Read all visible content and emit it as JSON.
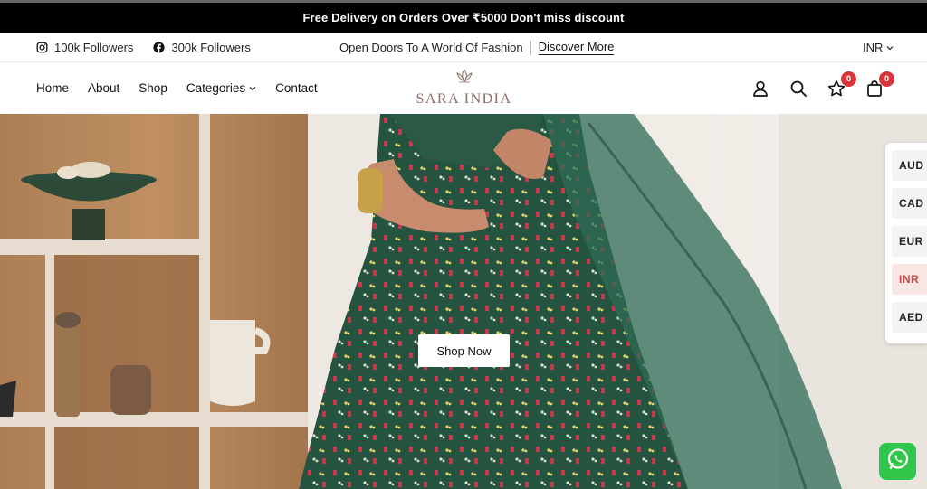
{
  "announcement": {
    "text": "Free Delivery on Orders Over ₹5000 Don't miss discount"
  },
  "utility": {
    "instagram_followers": "100k Followers",
    "facebook_followers": "300k Followers",
    "tagline": "Open Doors To A World Of Fashion",
    "discover_label": "Discover More",
    "currency_selected": "INR"
  },
  "nav": {
    "items": [
      {
        "label": "Home"
      },
      {
        "label": "About"
      },
      {
        "label": "Shop"
      },
      {
        "label": "Categories"
      },
      {
        "label": "Contact"
      }
    ]
  },
  "logo": {
    "text": "SARA INDIA"
  },
  "header_icons": {
    "wishlist_count": "0",
    "cart_count": "0",
    "icons": [
      "user-icon",
      "search-icon",
      "star-icon",
      "bag-icon"
    ]
  },
  "hero": {
    "cta_label": "Shop Now"
  },
  "currency_switcher": {
    "options": [
      "AUD",
      "CAD",
      "EUR",
      "INR",
      "AED"
    ],
    "active": "INR"
  },
  "colors": {
    "accent_badge": "#d9343a",
    "announcement_bg": "#000000",
    "whatsapp_green": "#2fc64a",
    "dress_green": "#24533f"
  }
}
